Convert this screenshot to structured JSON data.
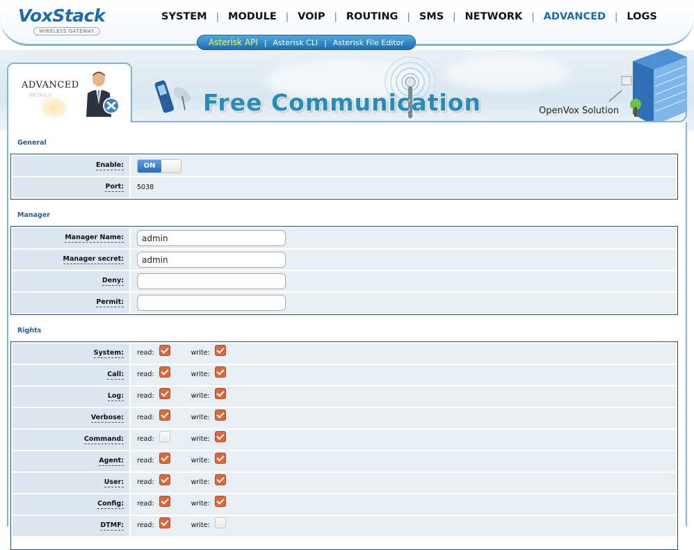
{
  "brand": {
    "name": "VoxStack",
    "tagline": "WIRELESS GATEWAY"
  },
  "nav": {
    "items": [
      {
        "label": "SYSTEM",
        "active": false
      },
      {
        "label": "MODULE",
        "active": false
      },
      {
        "label": "VOIP",
        "active": false
      },
      {
        "label": "ROUTING",
        "active": false
      },
      {
        "label": "SMS",
        "active": false
      },
      {
        "label": "NETWORK",
        "active": false
      },
      {
        "label": "ADVANCED",
        "active": true
      },
      {
        "label": "LOGS",
        "active": false
      }
    ],
    "separator": "|"
  },
  "subnav": {
    "items": [
      {
        "label": "Asterisk API",
        "active": true
      },
      {
        "label": "Asterisk CLI",
        "active": false
      },
      {
        "label": "Asterisk File Editor",
        "active": false
      }
    ],
    "separator": "|"
  },
  "banner": {
    "section_title": "ADVANCED",
    "section_subtitle": "DETAILS",
    "slogan": "Free Communication",
    "company": "OpenVox Solution"
  },
  "general": {
    "title": "General",
    "enable_label": "Enable:",
    "enable_state": "ON",
    "port_label": "Port:",
    "port_value": "5038"
  },
  "manager": {
    "title": "Manager",
    "name_label": "Manager Name:",
    "name_value": "admin",
    "secret_label": "Manager secret:",
    "secret_value": "admin",
    "deny_label": "Deny:",
    "deny_value": "",
    "permit_label": "Permit:",
    "permit_value": ""
  },
  "rights": {
    "title": "Rights",
    "read_label": "read:",
    "write_label": "write:",
    "rows": [
      {
        "label": "System:",
        "read": true,
        "write": true
      },
      {
        "label": "Call:",
        "read": true,
        "write": true
      },
      {
        "label": "Log:",
        "read": true,
        "write": true
      },
      {
        "label": "Verbose:",
        "read": true,
        "write": true
      },
      {
        "label": "Command:",
        "read": false,
        "write": true
      },
      {
        "label": "Agent:",
        "read": true,
        "write": true
      },
      {
        "label": "User:",
        "read": true,
        "write": true
      },
      {
        "label": "Config:",
        "read": true,
        "write": true
      },
      {
        "label": "DTMF:",
        "read": true,
        "write": false
      }
    ]
  },
  "colors": {
    "accent": "#1a6cab",
    "checkbox": "#d9683d",
    "border": "#1f4f7a",
    "label_bg": "#dbe6f0",
    "row_bg": "#e7eef4"
  }
}
